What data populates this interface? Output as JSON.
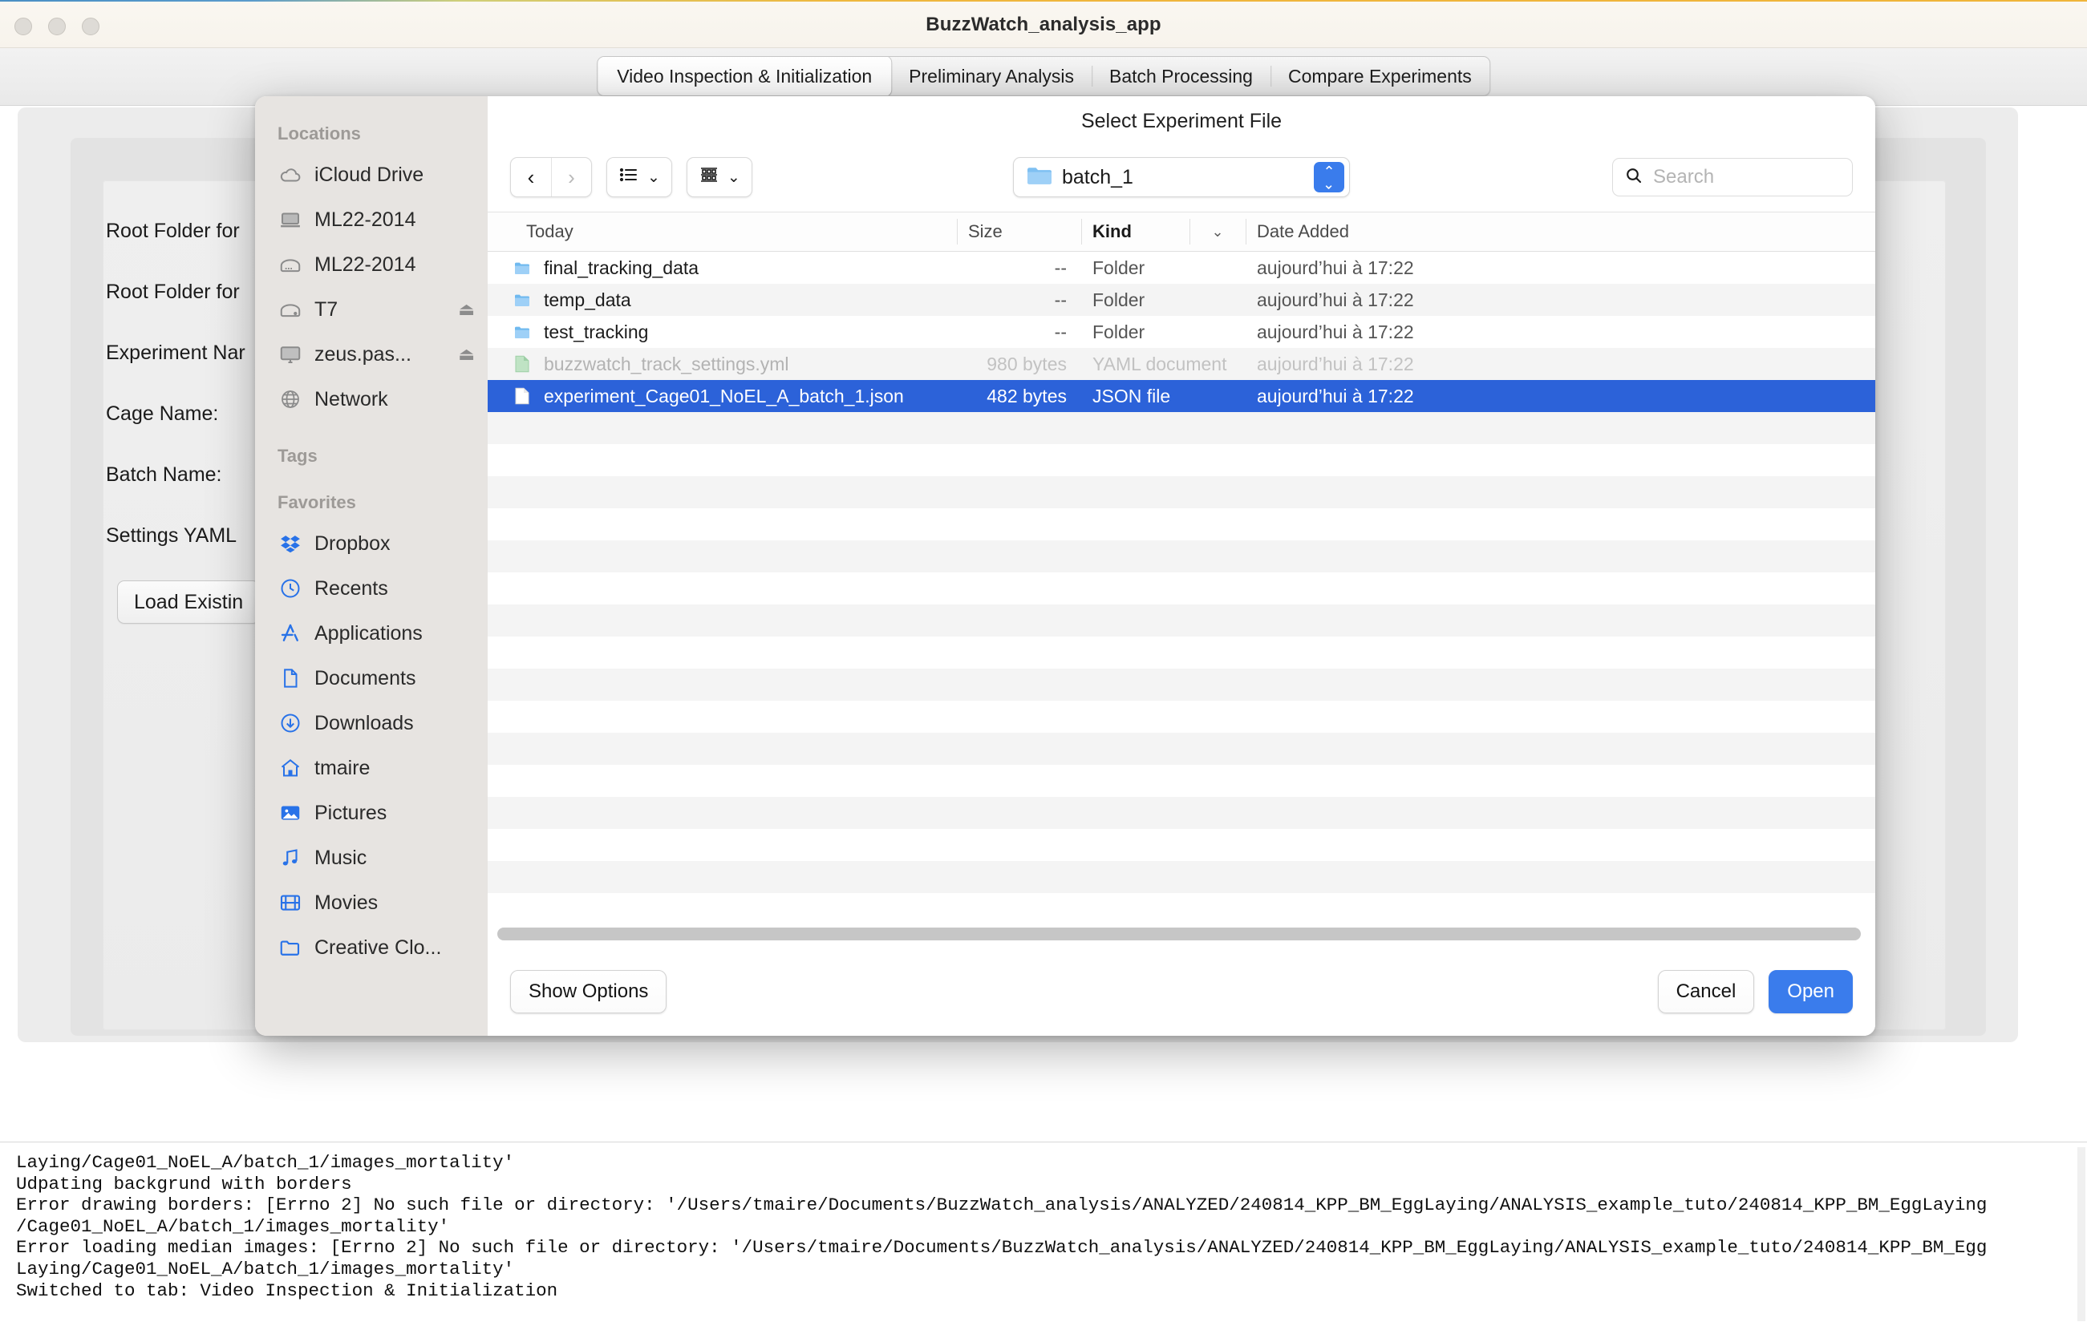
{
  "window": {
    "title": "BuzzWatch_analysis_app",
    "traffic_lights": [
      "close",
      "minimize",
      "zoom"
    ]
  },
  "tabs": [
    {
      "label": "Video Inspection & Initialization",
      "active": true
    },
    {
      "label": "Preliminary Analysis",
      "active": false
    },
    {
      "label": "Batch Processing",
      "active": false
    },
    {
      "label": "Compare Experiments",
      "active": false
    }
  ],
  "form": {
    "rows": [
      {
        "label": "Root Folder for"
      },
      {
        "label": "Root Folder for"
      },
      {
        "label": "Experiment Nar"
      },
      {
        "label": "Cage Name:"
      },
      {
        "label": "Batch Name:"
      },
      {
        "label": "Settings YAML"
      }
    ],
    "load_button": "Load Existin"
  },
  "dialog": {
    "title": "Select Experiment File",
    "sidebar": {
      "sections": [
        {
          "header": "Locations",
          "items": [
            {
              "label": "iCloud Drive",
              "icon": "icloud-icon",
              "eject": false
            },
            {
              "label": "ML22-2014",
              "icon": "laptop-icon",
              "eject": false
            },
            {
              "label": "ML22-2014",
              "icon": "harddisk-icon",
              "eject": false
            },
            {
              "label": "T7",
              "icon": "external-drive-icon",
              "eject": true
            },
            {
              "label": "zeus.pas...",
              "icon": "display-icon",
              "eject": true
            },
            {
              "label": "Network",
              "icon": "globe-icon",
              "eject": false
            }
          ]
        },
        {
          "header": "Tags",
          "items": []
        },
        {
          "header": "Favorites",
          "items": [
            {
              "label": "Dropbox",
              "icon": "dropbox-icon",
              "eject": false
            },
            {
              "label": "Recents",
              "icon": "clock-icon",
              "eject": false
            },
            {
              "label": "Applications",
              "icon": "applications-icon",
              "eject": false
            },
            {
              "label": "Documents",
              "icon": "document-icon",
              "eject": false
            },
            {
              "label": "Downloads",
              "icon": "download-icon",
              "eject": false
            },
            {
              "label": "tmaire",
              "icon": "home-icon",
              "eject": false
            },
            {
              "label": "Pictures",
              "icon": "pictures-icon",
              "eject": false
            },
            {
              "label": "Music",
              "icon": "music-icon",
              "eject": false
            },
            {
              "label": "Movies",
              "icon": "movies-icon",
              "eject": false
            },
            {
              "label": "Creative Clo...",
              "icon": "folder-icon",
              "eject": false
            }
          ]
        }
      ]
    },
    "toolbar": {
      "back_icon": "chevron-left-icon",
      "forward_icon": "chevron-right-icon",
      "view_list_icon": "list-view-icon",
      "view_grid_icon": "grid-view-icon",
      "path_label": "batch_1",
      "search_placeholder": "Search",
      "search_value": ""
    },
    "columns": [
      "Today",
      "Size",
      "Kind",
      "Date Added"
    ],
    "sort_column": "Kind",
    "files": [
      {
        "name": "final_tracking_data",
        "size": "--",
        "kind": "Folder",
        "date": "aujourd’hui à 17:22",
        "icon": "folder-icon",
        "state": "normal"
      },
      {
        "name": "temp_data",
        "size": "--",
        "kind": "Folder",
        "date": "aujourd’hui à 17:22",
        "icon": "folder-icon",
        "state": "normal"
      },
      {
        "name": "test_tracking",
        "size": "--",
        "kind": "Folder",
        "date": "aujourd’hui à 17:22",
        "icon": "folder-icon",
        "state": "normal"
      },
      {
        "name": "buzzwatch_track_settings.yml",
        "size": "980 bytes",
        "kind": "YAML document",
        "date": "aujourd’hui à 17:22",
        "icon": "yaml-file-icon",
        "state": "disabled"
      },
      {
        "name": "experiment_Cage01_NoEL_A_batch_1.json",
        "size": "482 bytes",
        "kind": "JSON file",
        "date": "aujourd’hui à 17:22",
        "icon": "json-file-icon",
        "state": "selected"
      }
    ],
    "footer": {
      "show_options": "Show Options",
      "cancel": "Cancel",
      "open": "Open"
    }
  },
  "console": {
    "text": "Laying/Cage01_NoEL_A/batch_1/images_mortality'\nUdpating backgrund with borders\nError drawing borders: [Errno 2] No such file or directory: '/Users/tmaire/Documents/BuzzWatch_analysis/ANALYZED/240814_KPP_BM_EggLaying/ANALYSIS_example_tuto/240814_KPP_BM_EggLaying\n/Cage01_NoEL_A/batch_1/images_mortality'\nError loading median images: [Errno 2] No such file or directory: '/Users/tmaire/Documents/BuzzWatch_analysis/ANALYZED/240814_KPP_BM_EggLaying/ANALYSIS_example_tuto/240814_KPP_BM_Egg\nLaying/Cage01_NoEL_A/batch_1/images_mortality'\nSwitched to tab: Video Inspection & Initialization"
  },
  "colors": {
    "accent": "#3a7cec",
    "selection": "#2c62d9",
    "sidebar_bg": "#e7e4e1",
    "titlebar_bg": "#f9f6f0"
  }
}
